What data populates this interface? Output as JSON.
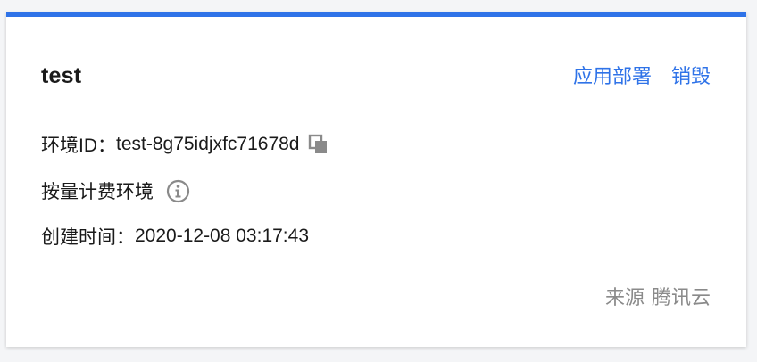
{
  "card": {
    "title": "test",
    "accent_color": "#2f73e8",
    "actions": {
      "deploy_label": "应用部署",
      "destroy_label": "销毁"
    },
    "env_id": {
      "label": "环境ID：",
      "value": "test-8g75idjxfc71678d"
    },
    "billing": {
      "label": "按量计费环境"
    },
    "created": {
      "label": "创建时间：",
      "value": "2020-12-08 03:17:43"
    },
    "source": {
      "label": "来源",
      "value": "腾讯云"
    }
  },
  "icons": {
    "copy": "copy-icon",
    "info": "info-icon"
  }
}
